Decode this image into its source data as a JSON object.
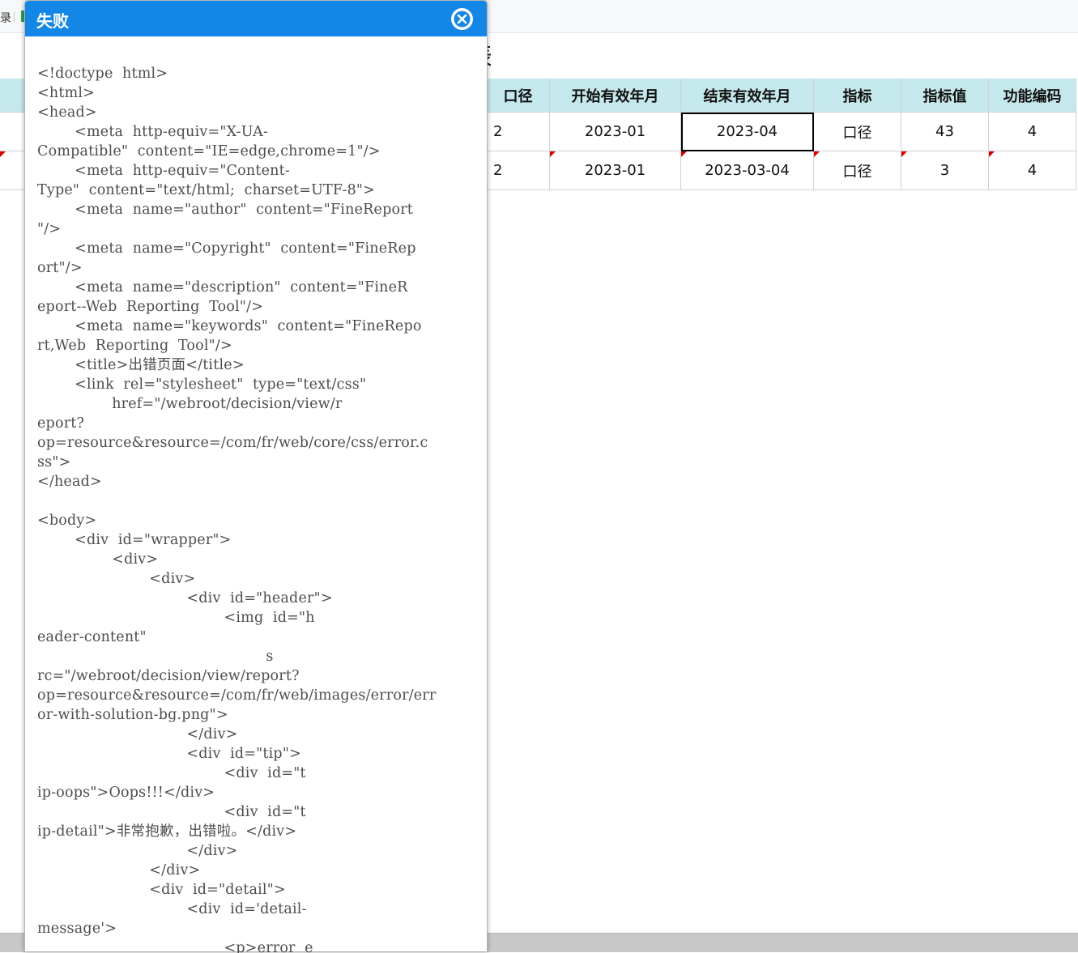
{
  "toolbar": {
    "clipped_text": "录"
  },
  "report": {
    "title_clipped_glyph": "表",
    "columns": [
      "口径",
      "开始有效年月",
      "结束有效年月",
      "指标",
      "指标值",
      "功能编码"
    ],
    "rows": [
      [
        "2",
        "2023-01",
        "2023-04",
        "口径",
        "43",
        "4"
      ],
      [
        "2",
        "2023-01",
        "2023-03-04",
        "口径",
        "3",
        "4"
      ]
    ],
    "selected_cell": "2023-04"
  },
  "dialog": {
    "title": "失败",
    "close_icon": "close-circle-icon",
    "header_color": "#1487e6",
    "source_lines": [
      "<!doctype  html>",
      "<html>",
      "<head>",
      "        <meta  http-equiv=\"X-UA-",
      "Compatible\"  content=\"IE=edge,chrome=1\"/>",
      "        <meta  http-equiv=\"Content-",
      "Type\"  content=\"text/html;  charset=UTF-8\">",
      "        <meta  name=\"author\"  content=\"FineReport",
      "\"/>",
      "        <meta  name=\"Copyright\"  content=\"FineRep",
      "ort\"/>",
      "        <meta  name=\"description\"  content=\"FineR",
      "eport--Web  Reporting  Tool\"/>",
      "        <meta  name=\"keywords\"  content=\"FineRepo",
      "rt,Web  Reporting  Tool\"/>",
      "        <title>出错页面</title>",
      "        <link  rel=\"stylesheet\"  type=\"text/css\"",
      "                href=\"/webroot/decision/view/r",
      "eport?",
      "op=resource&resource=/com/fr/web/core/css/error.c",
      "ss\">",
      "</head>",
      "",
      "<body>",
      "        <div  id=\"wrapper\">",
      "                <div>",
      "                        <div>",
      "                                <div  id=\"header\">",
      "                                        <img  id=\"h",
      "eader-content\"",
      "                                                 s",
      "rc=\"/webroot/decision/view/report?",
      "op=resource&resource=/com/fr/web/images/error/err",
      "or-with-solution-bg.png\">",
      "                                </div>",
      "                                <div  id=\"tip\">",
      "                                        <div  id=\"t",
      "ip-oops\">Oops!!!</div>",
      "                                        <div  id=\"t",
      "ip-detail\">非常抱歉，出错啦。</div>",
      "                                </div>",
      "                        </div>",
      "                        <div  id=\"detail\">",
      "                                <div  id='detail-",
      "message'>",
      "                                        <p>error  e"
    ]
  }
}
